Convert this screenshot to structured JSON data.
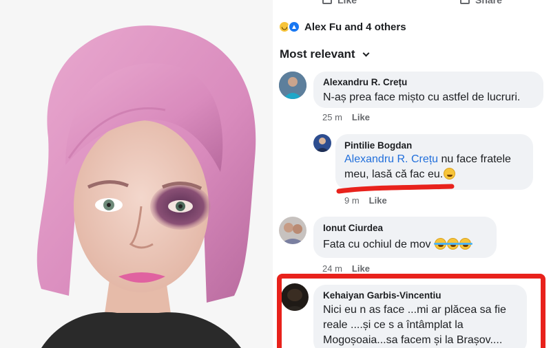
{
  "actions": {
    "like_label": "Like",
    "share_label": "Share"
  },
  "reactions": {
    "icons": [
      "haha-reaction-icon",
      "like-reaction-icon"
    ],
    "summary": "Alex Fu and 4 others"
  },
  "sort": {
    "label": "Most relevant"
  },
  "comments": [
    {
      "author": "Alexandru R. Crețu",
      "text": "N-aș prea face mișto cu astfel de lucruri.",
      "time": "25 m",
      "like": "Like"
    },
    {
      "author": "Pintilie Bogdan",
      "mention": "Alexandru R. Crețu",
      "text_line1": " nu face fratele",
      "text_line2": "meu, lasă că fac eu.",
      "emoji": "smile-emoji-icon",
      "time": "9 m",
      "like": "Like"
    },
    {
      "author": "Ionut Ciurdea",
      "text": "Fata cu ochiul de mov",
      "emoji": "rolling-laughing-emoji-icon",
      "time": "24 m",
      "like": "Like"
    },
    {
      "author": "Kehaiyan Garbis-Vincentiu",
      "text_line1": "Nici eu n as face ...mi ar plăcea sa fie",
      "text_line2": "reale ....și ce s a întâmplat la",
      "text_line3": "Mogoșoaia...sa facem și la Brașov...."
    }
  ],
  "colors": {
    "annotation": "#e8221c",
    "mention": "#216fdb",
    "bubble": "#f0f2f5",
    "hair": "#d98bbd"
  }
}
